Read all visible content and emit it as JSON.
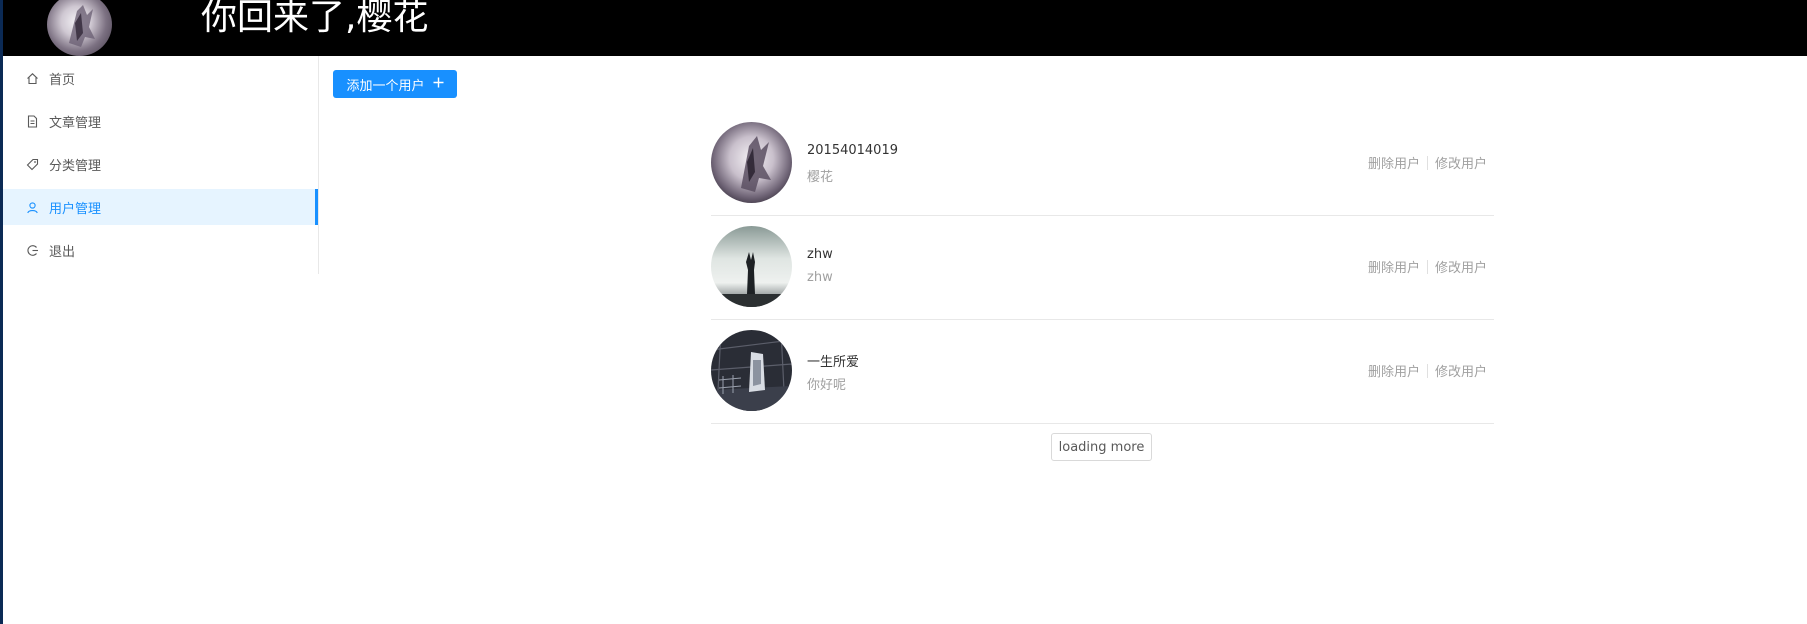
{
  "header": {
    "title": "你回来了,樱花",
    "avatar_icon": "user-avatar-illustration"
  },
  "sidebar": {
    "items": [
      {
        "label": "首页",
        "icon": "home-icon",
        "active": false
      },
      {
        "label": "文章管理",
        "icon": "file-text-icon",
        "active": false
      },
      {
        "label": "分类管理",
        "icon": "tag-icon",
        "active": false
      },
      {
        "label": "用户管理",
        "icon": "user-icon",
        "active": true
      },
      {
        "label": "退出",
        "icon": "logout-icon",
        "active": false
      }
    ]
  },
  "toolbar": {
    "add_label": "添加一个用户",
    "add_icon": "plus-icon"
  },
  "users": [
    {
      "name": "20154014019",
      "desc": "樱花",
      "delete_label": "删除用户",
      "edit_label": "修改用户"
    },
    {
      "name": "zhw",
      "desc": "zhw",
      "delete_label": "删除用户",
      "edit_label": "修改用户"
    },
    {
      "name": "一生所爱",
      "desc": "你好呢",
      "delete_label": "删除用户",
      "edit_label": "修改用户"
    }
  ],
  "load_more_label": "loading more",
  "colors": {
    "accent": "#1890ff",
    "active_bg": "#e6f4ff",
    "header_bg": "#000000"
  }
}
